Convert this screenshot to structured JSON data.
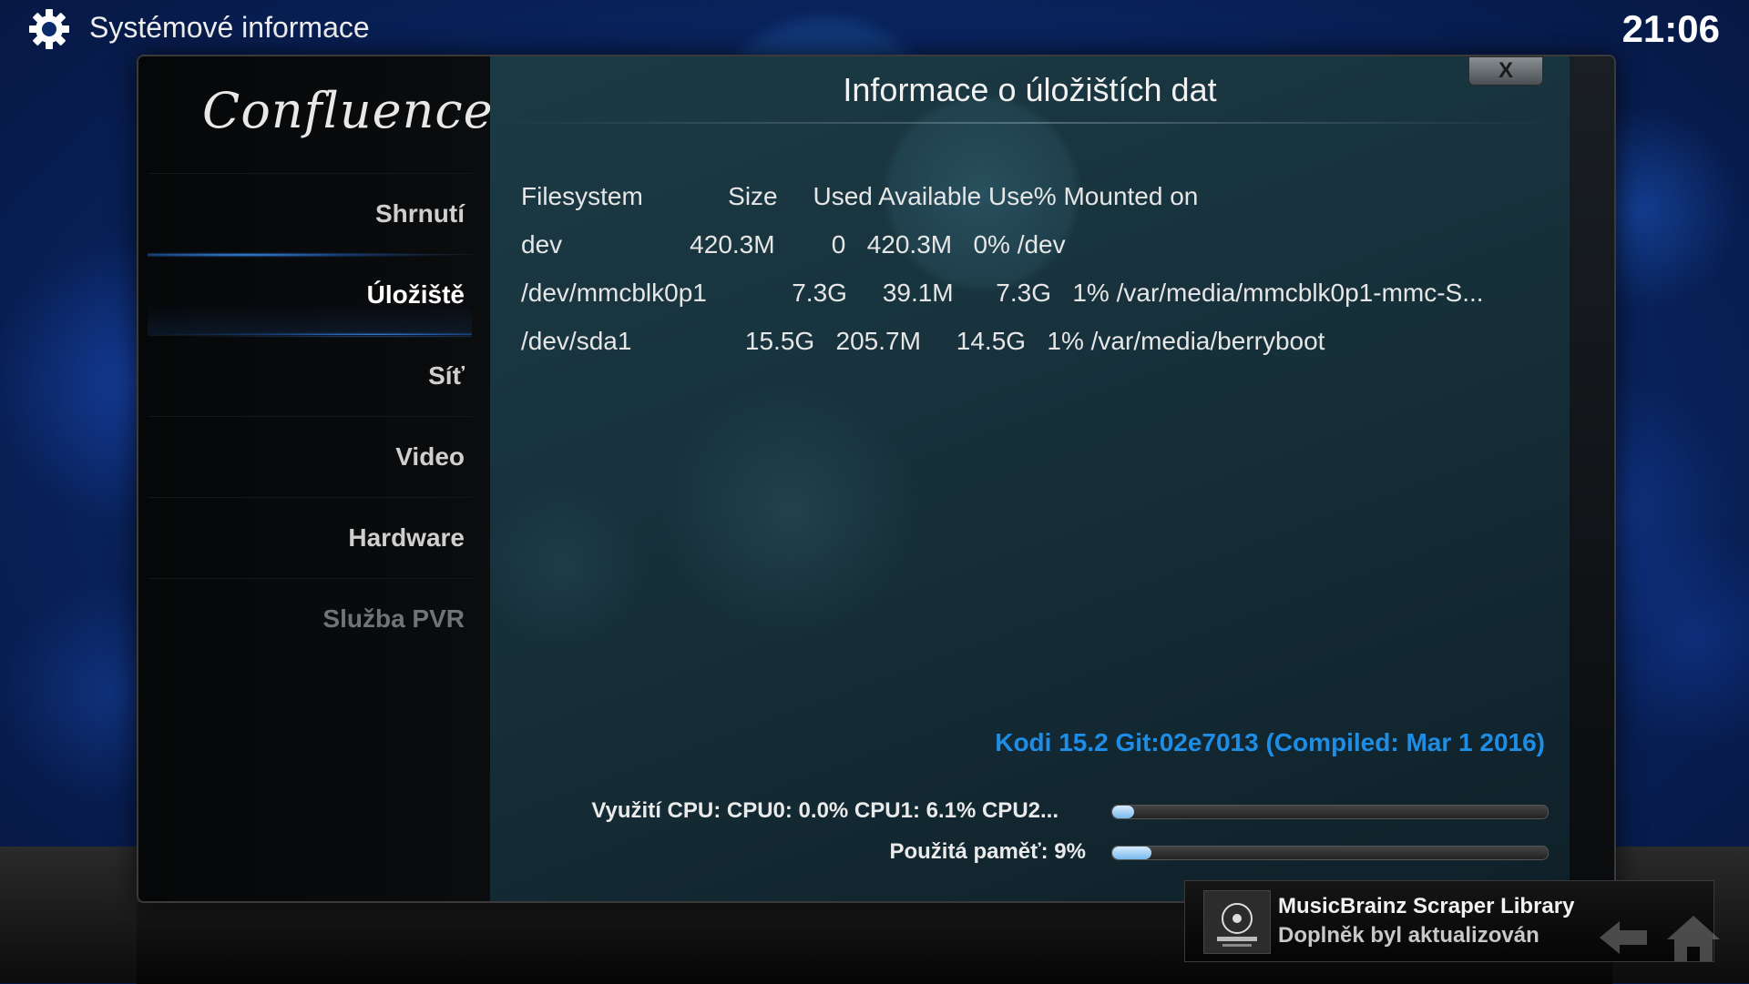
{
  "header": {
    "title": "Systémové informace",
    "clock": "21:06"
  },
  "sidebar": {
    "logo": "Confluence",
    "items": [
      {
        "label": "Shrnutí",
        "state": "normal"
      },
      {
        "label": "Úložiště",
        "state": "active"
      },
      {
        "label": "Síť",
        "state": "normal"
      },
      {
        "label": "Video",
        "state": "normal"
      },
      {
        "label": "Hardware",
        "state": "normal"
      },
      {
        "label": "Služba PVR",
        "state": "disabled"
      }
    ]
  },
  "dialog": {
    "title": "Informace o úložištích dat",
    "close_label": "X"
  },
  "storage": {
    "lines": [
      "Filesystem            Size     Used Available Use% Mounted on",
      "dev                  420.3M        0   420.3M   0% /dev",
      "/dev/mmcblk0p1            7.3G     39.1M      7.3G   1% /var/media/mmcblk0p1-mmc-S...",
      "/dev/sda1                15.5G   205.7M     14.5G   1% /var/media/berryboot"
    ]
  },
  "system": {
    "version": "Kodi 15.2 Git:02e7013 (Compiled: Mar  1 2016)",
    "cpu_label": "Využití CPU: CPU0: 0.0% CPU1: 6.1% CPU2...",
    "cpu_percent": 2,
    "memory_label": "Použitá paměť: 9%",
    "memory_percent": 9
  },
  "notification": {
    "title": "MusicBrainz Scraper Library",
    "message": "Doplněk byl aktualizován"
  },
  "colors": {
    "accent": "#1e8de6",
    "panel": "#17323c"
  },
  "icons": {
    "settings": "gear-icon",
    "close": "close-icon",
    "back": "back-arrow-icon",
    "home": "home-icon"
  }
}
